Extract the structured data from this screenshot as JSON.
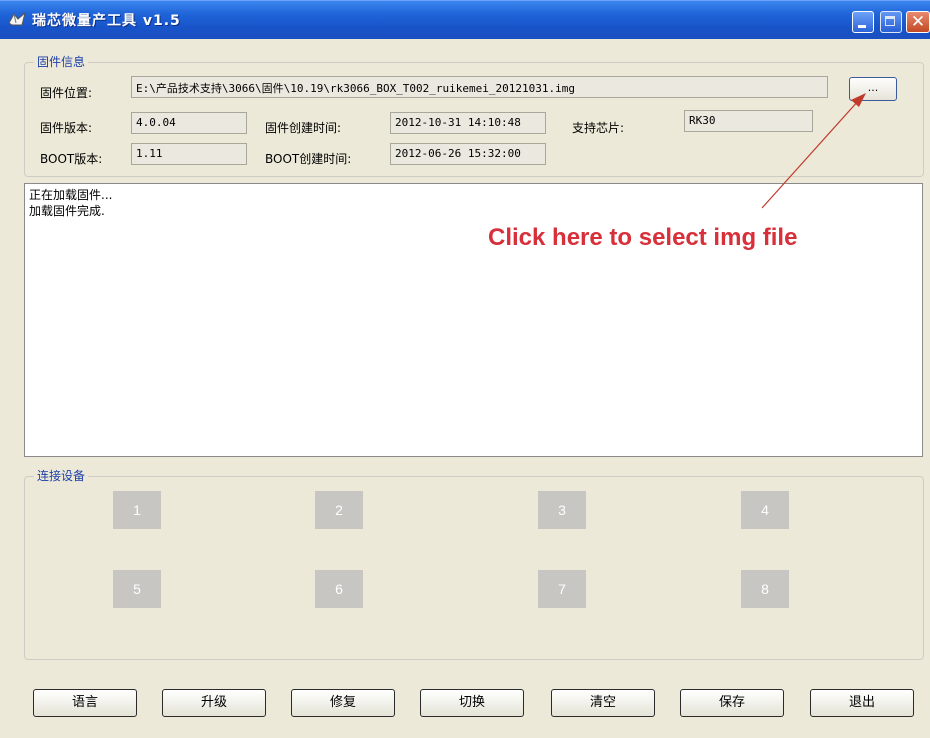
{
  "window": {
    "title": "瑞芯微量产工具 v1.5"
  },
  "firmware": {
    "group_label": "固件信息",
    "path_label": "固件位置:",
    "path_value": "E:\\产品技术支持\\3066\\固件\\10.19\\rk3066_BOX_T002_ruikemei_20121031.img",
    "browse_label": "...",
    "version_label": "固件版本:",
    "version_value": "4.0.04",
    "build_time_label": "固件创建时间:",
    "build_time_value": "2012-10-31 14:10:48",
    "chip_label": "支持芯片:",
    "chip_value": "RK30",
    "boot_version_label": "BOOT版本:",
    "boot_version_value": "1.11",
    "boot_time_label": "BOOT创建时间:",
    "boot_time_value": "2012-06-26 15:32:00"
  },
  "log": {
    "lines": [
      "正在加载固件...",
      "加载固件完成."
    ]
  },
  "annotation": {
    "text": "Click here to select img file",
    "color": "#d8303a"
  },
  "devices": {
    "group_label": "连接设备",
    "slots": [
      "1",
      "2",
      "3",
      "4",
      "5",
      "6",
      "7",
      "8"
    ]
  },
  "buttons": {
    "language": "语言",
    "upgrade": "升级",
    "repair": "修复",
    "switch": "切换",
    "clear": "清空",
    "save": "保存",
    "exit": "退出"
  }
}
